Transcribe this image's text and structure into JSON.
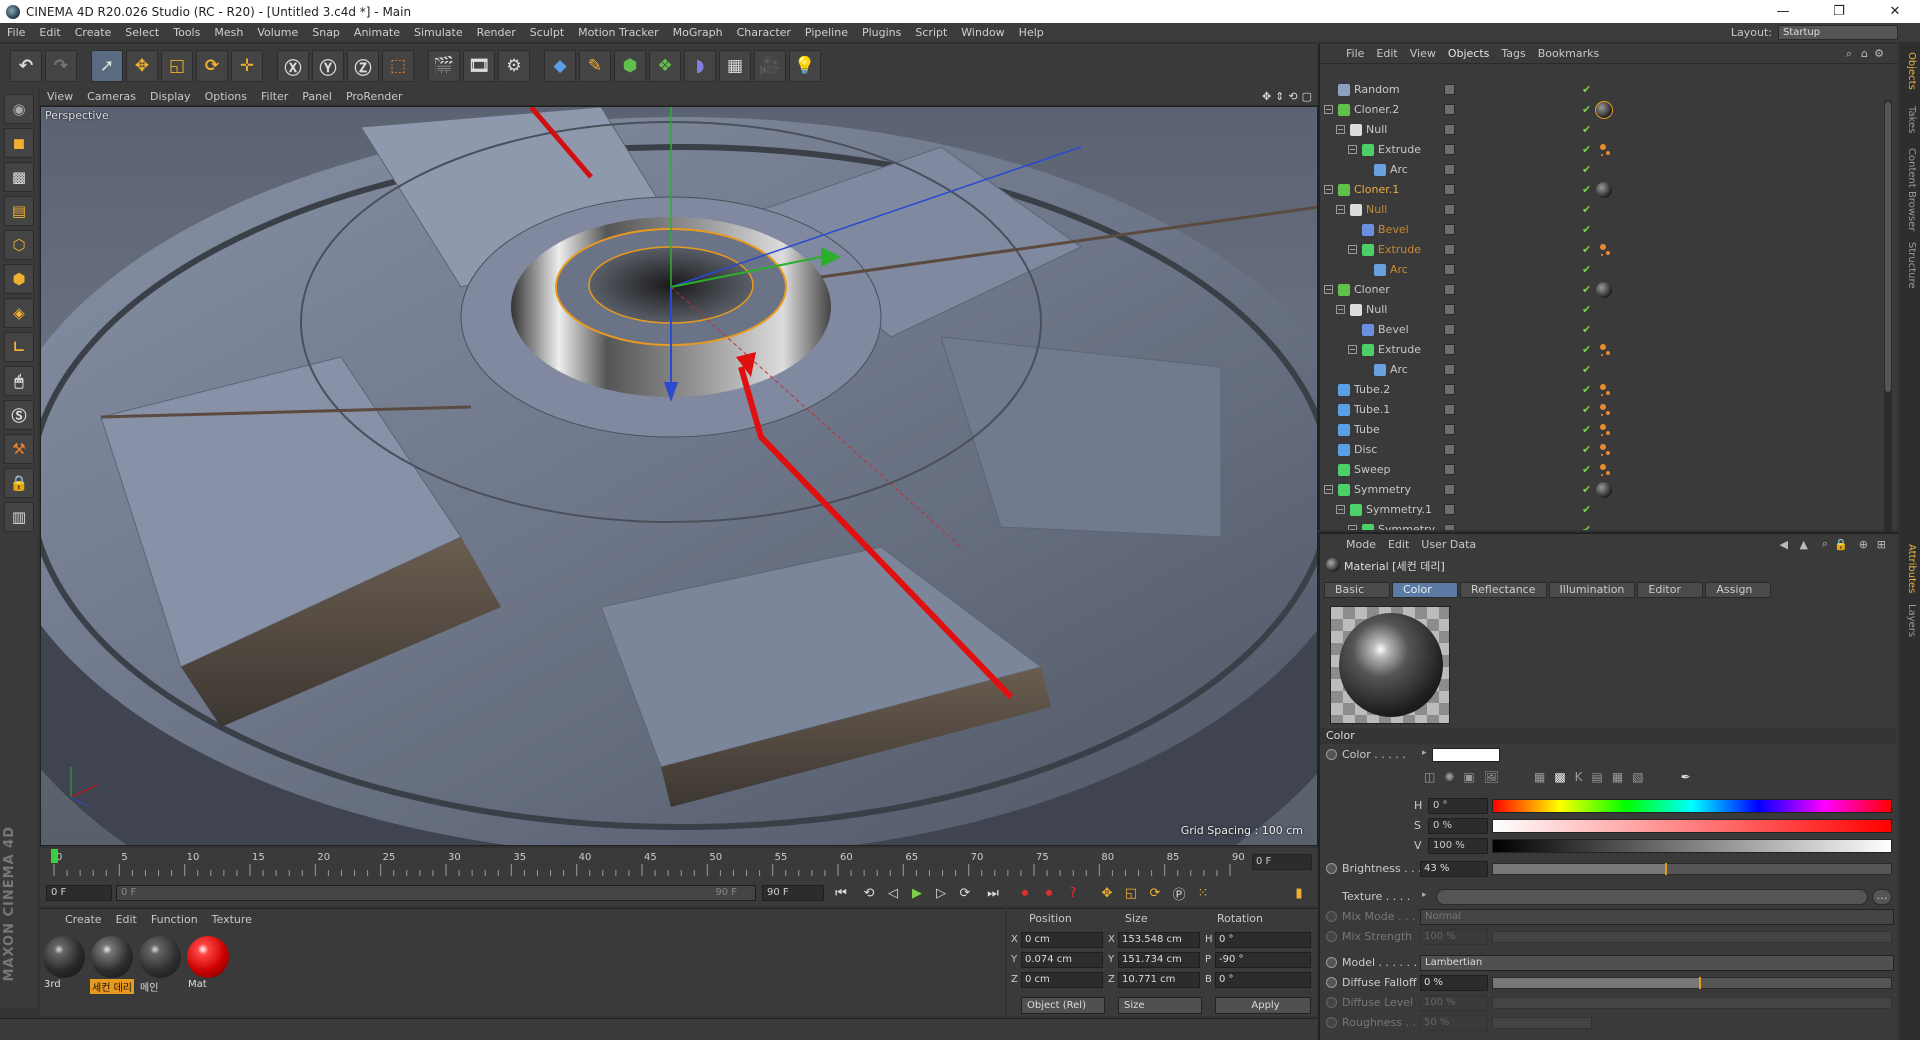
{
  "window": {
    "title": "CINEMA 4D R20.026 Studio (RC - R20) - [Untitled 3.c4d *] - Main",
    "minimize": "—",
    "restore": "❐",
    "close": "✕"
  },
  "menubar": {
    "items": [
      "File",
      "Edit",
      "Create",
      "Select",
      "Tools",
      "Mesh",
      "Volume",
      "Snap",
      "Animate",
      "Simulate",
      "Render",
      "Sculpt",
      "Motion Tracker",
      "MoGraph",
      "Character",
      "Pipeline",
      "Plugins",
      "Script",
      "Window",
      "Help"
    ],
    "layout_label": "Layout:",
    "layout_value": "Startup"
  },
  "viewport": {
    "menu": [
      "View",
      "Cameras",
      "Display",
      "Options",
      "Filter",
      "Panel",
      "ProRender"
    ],
    "camera_label": "Perspective",
    "grid_spacing": "Grid Spacing : 100 cm"
  },
  "timeline": {
    "ticks": [
      "0",
      "5",
      "10",
      "15",
      "20",
      "25",
      "30",
      "35",
      "40",
      "45",
      "50",
      "55",
      "60",
      "65",
      "70",
      "75",
      "80",
      "85",
      "90"
    ],
    "current_frame": "0 F",
    "start_field": "0 F",
    "range_start": "0 F",
    "range_end": "90 F",
    "end_field": "90 F"
  },
  "materials": {
    "menu": [
      "Create",
      "Edit",
      "Function",
      "Texture"
    ],
    "items": [
      {
        "name": "3rd",
        "selected": false,
        "color": "#2a2a2a"
      },
      {
        "name": "세컨 데리",
        "selected": true,
        "color": "#2e2e2e"
      },
      {
        "name": "메인",
        "selected": false,
        "color": "#303030"
      },
      {
        "name": "Mat",
        "selected": false,
        "color": "#d01010"
      }
    ]
  },
  "coordinates": {
    "headers": [
      "Position",
      "Size",
      "Rotation"
    ],
    "rows": [
      {
        "axis": "X",
        "pos": "0 cm",
        "size_axis": "X",
        "size": "153.548 cm",
        "rot_axis": "H",
        "rot": "0 °"
      },
      {
        "axis": "Y",
        "pos": "0.074 cm",
        "size_axis": "Y",
        "size": "151.734 cm",
        "rot_axis": "P",
        "rot": "-90 °"
      },
      {
        "axis": "Z",
        "pos": "0 cm",
        "size_axis": "Z",
        "size": "10.771 cm",
        "rot_axis": "B",
        "rot": "0 °"
      }
    ],
    "mode": "Object (Rel)",
    "size_mode": "Size",
    "apply": "Apply"
  },
  "objects": {
    "menu": [
      "File",
      "Edit",
      "View",
      "Objects",
      "Tags",
      "Bookmarks"
    ],
    "rows": [
      {
        "name": "Random",
        "indent": 0,
        "icon": "#8ca0c0",
        "twist": "",
        "style": "",
        "tag": ""
      },
      {
        "name": "Cloner.2",
        "indent": 0,
        "icon": "#5fc04a",
        "twist": "−",
        "style": "",
        "tag": "mat-act"
      },
      {
        "name": "Null",
        "indent": 1,
        "icon": "#dcdcdc",
        "twist": "−",
        "style": "",
        "tag": ""
      },
      {
        "name": "Extrude",
        "indent": 2,
        "icon": "#4bd06a",
        "twist": "−",
        "style": "",
        "tag": "phong"
      },
      {
        "name": "Arc",
        "indent": 3,
        "icon": "#6aa0e0",
        "twist": "",
        "style": "",
        "tag": ""
      },
      {
        "name": "Cloner.1",
        "indent": 0,
        "icon": "#5fc04a",
        "twist": "−",
        "style": "hl",
        "tag": "mat"
      },
      {
        "name": "Null",
        "indent": 1,
        "icon": "#dcdcdc",
        "twist": "−",
        "style": "hl2",
        "tag": ""
      },
      {
        "name": "Bevel",
        "indent": 2,
        "icon": "#6b8fe0",
        "twist": "",
        "style": "hl2",
        "tag": ""
      },
      {
        "name": "Extrude",
        "indent": 2,
        "icon": "#4bd06a",
        "twist": "−",
        "style": "hl2",
        "tag": "phong"
      },
      {
        "name": "Arc",
        "indent": 3,
        "icon": "#6aa0e0",
        "twist": "",
        "style": "hl2",
        "tag": ""
      },
      {
        "name": "Cloner",
        "indent": 0,
        "icon": "#5fc04a",
        "twist": "−",
        "style": "",
        "tag": "mat"
      },
      {
        "name": "Null",
        "indent": 1,
        "icon": "#dcdcdc",
        "twist": "−",
        "style": "",
        "tag": ""
      },
      {
        "name": "Bevel",
        "indent": 2,
        "icon": "#6b8fe0",
        "twist": "",
        "style": "",
        "tag": ""
      },
      {
        "name": "Extrude",
        "indent": 2,
        "icon": "#4bd06a",
        "twist": "−",
        "style": "",
        "tag": "phong"
      },
      {
        "name": "Arc",
        "indent": 3,
        "icon": "#6aa0e0",
        "twist": "",
        "style": "",
        "tag": ""
      },
      {
        "name": "Tube.2",
        "indent": 0,
        "icon": "#5aa0e8",
        "twist": "",
        "style": "",
        "tag": "phong"
      },
      {
        "name": "Tube.1",
        "indent": 0,
        "icon": "#5aa0e8",
        "twist": "",
        "style": "",
        "tag": "phong"
      },
      {
        "name": "Tube",
        "indent": 0,
        "icon": "#5aa0e8",
        "twist": "",
        "style": "",
        "tag": "phong"
      },
      {
        "name": "Disc",
        "indent": 0,
        "icon": "#5aa0e8",
        "twist": "",
        "style": "",
        "tag": "phong"
      },
      {
        "name": "Sweep",
        "indent": 0,
        "icon": "#4bd06a",
        "twist": "",
        "style": "",
        "tag": "phong"
      },
      {
        "name": "Symmetry",
        "indent": 0,
        "icon": "#4bd06a",
        "twist": "−",
        "style": "",
        "tag": "mat"
      },
      {
        "name": "Symmetry.1",
        "indent": 1,
        "icon": "#4bd06a",
        "twist": "−",
        "style": "",
        "tag": ""
      },
      {
        "name": "Symmetry",
        "indent": 2,
        "icon": "#4bd06a",
        "twist": "−",
        "style": "",
        "tag": ""
      }
    ]
  },
  "attributes": {
    "menu": [
      "Mode",
      "Edit",
      "User Data"
    ],
    "title": "Material [세컨 데리]",
    "tabs": [
      "Basic",
      "Color",
      "Reflectance",
      "Illumination",
      "Editor",
      "Assign"
    ],
    "active_tab": "Color",
    "section": "Color",
    "color_label": "Color . . . . .",
    "h_label": "H",
    "h_value": "0 °",
    "s_label": "S",
    "s_value": "0 %",
    "v_label": "V",
    "v_value": "100 %",
    "brightness_label": "Brightness . . .",
    "brightness_value": "43 %",
    "brightness_fraction": 0.43,
    "texture_label": "Texture . . . .",
    "mix_mode_label": "Mix Mode . . .",
    "mix_mode_value": "Normal",
    "mix_strength_label": "Mix Strength",
    "mix_strength_value": "100 %",
    "model_label": "Model . . . . . .",
    "model_value": "Lambertian",
    "diffuse_falloff_label": "Diffuse Falloff",
    "diffuse_falloff_value": "0 %",
    "diffuse_level_label": "Diffuse Level",
    "diffuse_level_value": "100 %",
    "roughness_label": "Roughness . . .",
    "roughness_value": "50 %"
  },
  "side_tabs": [
    "Objects",
    "Takes",
    "Content Browser",
    "Structure",
    "Attributes",
    "Layers"
  ],
  "brand": "MAXON CINEMA 4D",
  "colors": {
    "accent": "#e89a20",
    "selected_tab": "#5b7ba4",
    "check": "#7cd04a"
  }
}
